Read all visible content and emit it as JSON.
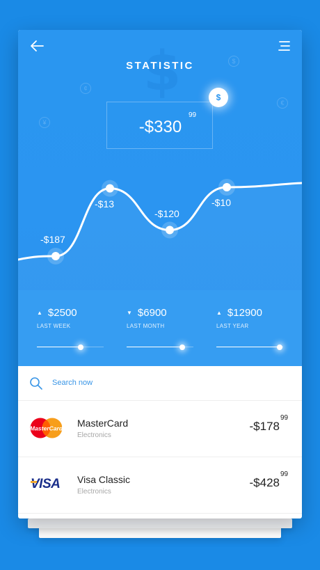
{
  "header": {
    "title": "STATISTIC",
    "total_amount": "-$330",
    "total_cents": "99",
    "currency_button": "$"
  },
  "chart_data": {
    "type": "line",
    "series": [
      {
        "points": [
          {
            "label": "-$187",
            "value": -187
          },
          {
            "label": "-$13",
            "value": -13
          },
          {
            "label": "-$120",
            "value": -120
          },
          {
            "label": "-$10",
            "value": -10
          }
        ]
      }
    ],
    "grid": false,
    "line_color": "#ffffff"
  },
  "stats": [
    {
      "direction": "up",
      "arrow": "▲",
      "value": "$2500",
      "label": "LAST WEEK",
      "slider": 0.66
    },
    {
      "direction": "down",
      "arrow": "▼",
      "value": "$6900",
      "label": "LAST MONTH",
      "slider": 0.83
    },
    {
      "direction": "up",
      "arrow": "▲",
      "value": "$12900",
      "label": "LAST YEAR",
      "slider": 0.95
    }
  ],
  "search": {
    "placeholder": "Search now"
  },
  "transactions": [
    {
      "name": "MasterCard",
      "category": "Electronics",
      "amount": "-$178",
      "cents": "99",
      "logo": "mastercard-logo",
      "logo_text": "MasterCard"
    },
    {
      "name": "Visa Classic",
      "category": "Electronics",
      "amount": "-$428",
      "cents": "99",
      "logo": "visa-logo",
      "logo_text": "VISA"
    }
  ],
  "colors": {
    "background": "#1a8ae6",
    "header": "#2a96f0",
    "accent": "#3895e6",
    "text": "#222222",
    "muted": "#a6a6a6"
  }
}
